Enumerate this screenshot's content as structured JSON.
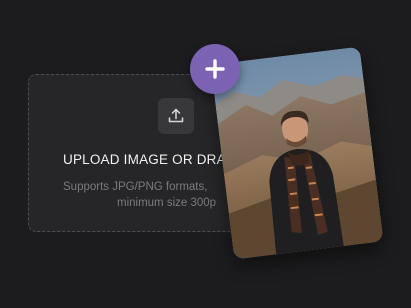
{
  "upload": {
    "title": "UPLOAD IMAGE OR DRA",
    "hint_line1": "Supports JPG/PNG formats,",
    "hint_line2": "minimum size 300p",
    "icon": "upload-icon"
  },
  "add_button": {
    "icon": "plus-icon",
    "color": "#7b62b3"
  },
  "colors": {
    "background": "#1c1c1e",
    "dropzone": "#262628",
    "accent": "#7b62b3"
  }
}
